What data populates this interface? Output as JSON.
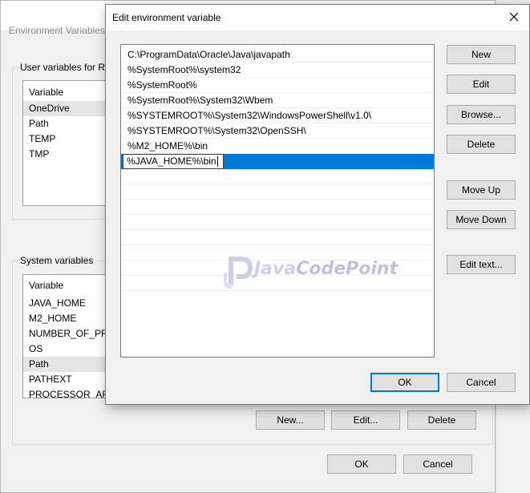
{
  "bg_window": {
    "title": "Environment Variables",
    "user_group_label": "User variables for RA",
    "user_list": {
      "header": "Variable",
      "rows": [
        "OneDrive",
        "Path",
        "TEMP",
        "TMP"
      ]
    },
    "system_group_label": "System variables",
    "system_list": {
      "header": "Variable",
      "rows": [
        "JAVA_HOME",
        "M2_HOME",
        "NUMBER_OF_PRO",
        "OS",
        "Path",
        "PATHEXT",
        "PROCESSOR_ARCH"
      ]
    },
    "buttons": {
      "new": "New...",
      "edit": "Edit...",
      "delete": "Delete",
      "ok": "OK",
      "cancel": "Cancel"
    }
  },
  "dialog": {
    "title": "Edit environment variable",
    "paths": [
      "C:\\ProgramData\\Oracle\\Java\\javapath",
      "%SystemRoot%\\system32",
      "%SystemRoot%",
      "%SystemRoot%\\System32\\Wbem",
      "%SYSTEMROOT%\\System32\\WindowsPowerShell\\v1.0\\",
      "%SYSTEMROOT%\\System32\\OpenSSH\\",
      "%M2_HOME%\\bin"
    ],
    "editing_value": "%JAVA_HOME%\\bin",
    "buttons": {
      "new": "New",
      "edit": "Edit",
      "browse": "Browse...",
      "delete": "Delete",
      "move_up": "Move Up",
      "move_down": "Move Down",
      "edit_text": "Edit text...",
      "ok": "OK",
      "cancel": "Cancel"
    }
  },
  "watermark": {
    "prefix": "Java",
    "suffix": "CodePoint"
  },
  "colors": {
    "selection": "#0078d7",
    "accent": "#0078d7"
  },
  "icons": {
    "close": "close-icon",
    "logo": "javacodepoint-logo-icon"
  }
}
